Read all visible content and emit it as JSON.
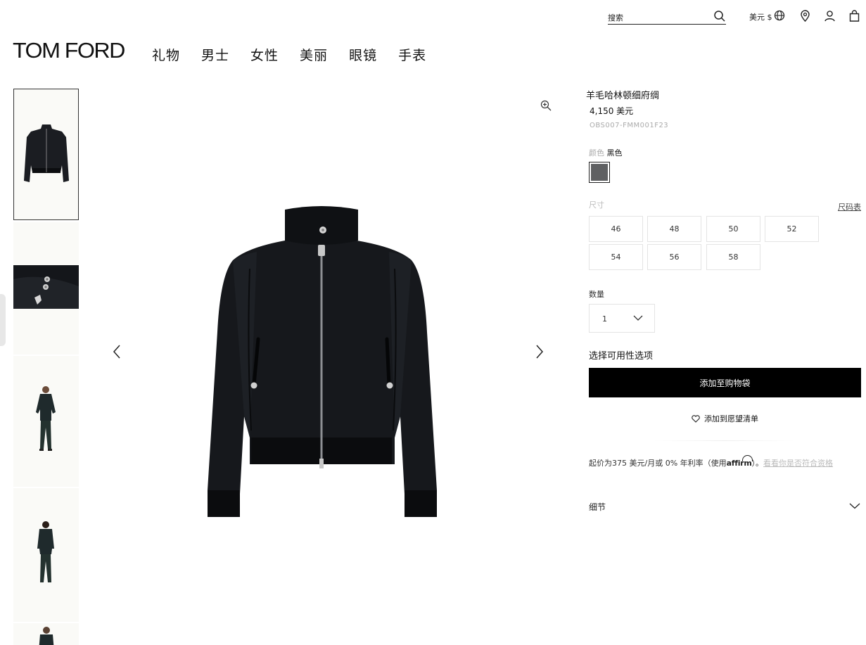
{
  "header": {
    "search_placeholder": "搜索",
    "currency": "美元 $",
    "logo": "TOM FORD",
    "nav": [
      "礼物",
      "男士",
      "女性",
      "美丽",
      "眼镜",
      "手表"
    ]
  },
  "product": {
    "name": "羊毛哈林顿细府绸",
    "price": "4,150 美元",
    "sku": "OBS007-FMM001F23",
    "color_label": "颜色",
    "color_value": "黑色",
    "swatch_color": "#5f6062",
    "size_label": "尺寸",
    "size_guide": "尺码表",
    "sizes": [
      "46",
      "48",
      "50",
      "52",
      "54",
      "56",
      "58"
    ],
    "quantity_label": "数量",
    "quantity": "1",
    "availability": "选择可用性选项",
    "add_to_bag": "添加至购物袋",
    "wishlist": "添加到愿望清单",
    "finance_text": "起价为375 美元/月或 0% 年利率（使用",
    "finance_brand": "affirm",
    "finance_close": "）。",
    "finance_link": "看看你是否符合资格",
    "details": "细节"
  },
  "colors": {
    "button_bg": "#000000",
    "jacket": "#16181c"
  }
}
